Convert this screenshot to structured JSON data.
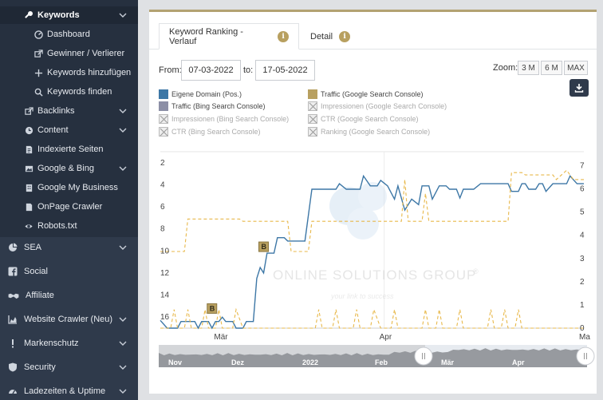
{
  "sidebar": {
    "keywords_label": "Keywords",
    "sub_items": [
      {
        "label": "Dashboard",
        "icon": "gauge-icon"
      },
      {
        "label": "Gewinner / Verlierer",
        "icon": "external-link-icon"
      },
      {
        "label": "Keywords hinzufügen",
        "icon": "plus-icon"
      },
      {
        "label": "Keywords finden",
        "icon": "search-icon"
      }
    ],
    "items": [
      {
        "label": "Backlinks",
        "icon": "external-link-icon"
      },
      {
        "label": "Content",
        "icon": "clock-icon"
      },
      {
        "label": "Indexierte Seiten",
        "icon": "document-icon"
      },
      {
        "label": "Google & Bing",
        "icon": "image-icon"
      },
      {
        "label": "Google My Business",
        "icon": "building-icon"
      },
      {
        "label": "OnPage Crawler",
        "icon": "file-icon"
      },
      {
        "label": "Robots.txt",
        "icon": "eye-icon"
      }
    ],
    "main_items": [
      {
        "label": "SEA",
        "icon": "pie-chart-icon"
      },
      {
        "label": "Social",
        "icon": "facebook-icon"
      },
      {
        "label": "Affiliate",
        "icon": "handshake-icon"
      },
      {
        "label": "Website Crawler (Neu)",
        "icon": "area-chart-icon"
      },
      {
        "label": "Markenschutz",
        "icon": "exclamation-icon"
      },
      {
        "label": "Security",
        "icon": "shield-icon"
      },
      {
        "label": "Ladezeiten & Uptime",
        "icon": "speedometer-icon"
      }
    ]
  },
  "tabs": [
    {
      "label": "Keyword Ranking - Verlauf",
      "info": "i"
    },
    {
      "label": "Detail",
      "info": "i"
    }
  ],
  "filters": {
    "from_label": "From:",
    "from_value": "07-03-2022",
    "to_label": "to:",
    "to_value": "17-05-2022",
    "zoom_label": "Zoom:",
    "zoom_options": [
      "3 M",
      "6 M",
      "MAX"
    ]
  },
  "legend": [
    {
      "label": "Eigene Domain (Pos.)",
      "color": "#3d77a6",
      "active": true
    },
    {
      "label": "Traffic (Google Search Console)",
      "color": "#b8a060",
      "active": true
    },
    {
      "label": "Traffic (Bing Search Console)",
      "color": "#8c8fa6",
      "active": true
    },
    {
      "label": "Impressionen (Google Search Console)",
      "active": false
    },
    {
      "label": "Impressionen (Bing Search Console)",
      "active": false
    },
    {
      "label": "CTR (Google Search Console)",
      "active": false
    },
    {
      "label": "CTR (Bing Search Console)",
      "active": false
    },
    {
      "label": "Ranking (Google Search Console)",
      "active": false
    }
  ],
  "watermark": {
    "brand": "ONLINE SOLUTIONS GROUP",
    "reg": "®",
    "tagline": "your link to success"
  },
  "chart_data": {
    "type": "line",
    "x_ticks": [
      "Mär",
      "Apr",
      "Ma"
    ],
    "y_left": {
      "ticks": [
        2,
        4,
        6,
        8,
        10,
        12,
        14,
        16
      ],
      "reversed": true,
      "range": [
        1,
        17
      ]
    },
    "y_right": {
      "ticks": [
        0,
        1,
        2,
        3,
        4,
        5,
        6,
        7
      ],
      "range": [
        0,
        7.6
      ]
    },
    "annotation_label": "B",
    "annotations": [
      {
        "day": 15,
        "pos": 15.8
      },
      {
        "day": 30,
        "pos": 10.2
      }
    ],
    "series": [
      {
        "name": "Eigene Domain (Pos.)",
        "axis": "left",
        "color": "#3d77a6",
        "style": "solid",
        "points": [
          [
            0,
            16.3
          ],
          [
            2,
            17
          ],
          [
            5,
            17
          ],
          [
            6,
            16.4
          ],
          [
            10,
            16.4
          ],
          [
            11,
            17
          ],
          [
            12,
            16.4
          ],
          [
            14,
            16.4
          ],
          [
            15,
            17
          ],
          [
            16,
            16.4
          ],
          [
            17,
            16.4
          ],
          [
            18,
            16
          ],
          [
            19,
            16.4
          ],
          [
            21,
            16.4
          ],
          [
            22,
            17
          ],
          [
            24,
            17
          ],
          [
            25,
            16.4
          ],
          [
            27,
            16.4
          ],
          [
            28,
            12.5
          ],
          [
            29,
            11.5
          ],
          [
            30,
            12
          ],
          [
            31,
            10.2
          ],
          [
            33,
            10.2
          ],
          [
            34,
            8.8
          ],
          [
            36,
            8.8
          ],
          [
            37,
            9.1
          ],
          [
            42,
            9.1
          ],
          [
            44,
            4.4
          ],
          [
            51,
            4.4
          ],
          [
            52,
            3.9
          ],
          [
            54,
            4.4
          ],
          [
            58,
            4.4
          ],
          [
            59,
            3.2
          ],
          [
            61,
            4.1
          ],
          [
            63,
            4.1
          ],
          [
            64,
            3.6
          ],
          [
            66,
            4.1
          ],
          [
            68,
            5.3
          ],
          [
            69,
            4.1
          ],
          [
            71,
            6.3
          ],
          [
            72,
            5.8
          ],
          [
            73,
            5.3
          ],
          [
            75,
            5.8
          ],
          [
            76,
            4.1
          ],
          [
            78,
            4.1
          ],
          [
            79,
            5.3
          ],
          [
            81,
            4.1
          ],
          [
            83,
            4.1
          ],
          [
            84,
            4.4
          ],
          [
            86,
            4.4
          ],
          [
            87,
            5.2
          ],
          [
            88,
            4.4
          ],
          [
            91,
            4.4
          ],
          [
            93,
            3.9
          ],
          [
            96,
            3.9
          ],
          [
            101,
            3.9
          ],
          [
            102,
            4.6
          ],
          [
            104,
            4.6
          ],
          [
            105,
            3.9
          ],
          [
            106,
            3.9
          ],
          [
            107,
            4.4
          ],
          [
            109,
            4.4
          ],
          [
            110,
            3.9
          ],
          [
            111,
            3.9
          ],
          [
            112,
            4.6
          ],
          [
            114,
            3.9
          ],
          [
            118,
            3.9
          ],
          [
            119,
            3.2
          ],
          [
            121,
            3.9
          ],
          [
            123,
            3.9
          ]
        ]
      },
      {
        "name": "Traffic (Google Search Console)",
        "axis": "right",
        "color": "#e8b84a",
        "style": "dashed",
        "points": [
          [
            0,
            3.3
          ],
          [
            7,
            3.3
          ],
          [
            8,
            4.7
          ],
          [
            23,
            4.7
          ],
          [
            24,
            4.6
          ],
          [
            37,
            4.6
          ],
          [
            38,
            3.3
          ],
          [
            43,
            3.3
          ],
          [
            44,
            4.6
          ],
          [
            70,
            4.6
          ],
          [
            71,
            6.4
          ],
          [
            72,
            4.6
          ],
          [
            76,
            4.6
          ],
          [
            77,
            5.8
          ],
          [
            78,
            4.6
          ],
          [
            83,
            4.6
          ],
          [
            84,
            4.6
          ],
          [
            101,
            4.6
          ],
          [
            102,
            6.7
          ],
          [
            105,
            6.7
          ],
          [
            106,
            6.6
          ],
          [
            110,
            6.6
          ],
          [
            114,
            6.6
          ],
          [
            115,
            6.4
          ],
          [
            118,
            6.8
          ],
          [
            120,
            6.4
          ],
          [
            123,
            6.4
          ]
        ]
      },
      {
        "name": "Traffic (Google Search Console) low",
        "axis": "right",
        "color": "#e8b84a",
        "style": "dashed",
        "points": [
          [
            0,
            0
          ],
          [
            3,
            0
          ],
          [
            4,
            0.8
          ],
          [
            5,
            0
          ],
          [
            7,
            0
          ],
          [
            8,
            0.8
          ],
          [
            9,
            0
          ],
          [
            12,
            0
          ],
          [
            13,
            0.8
          ],
          [
            14,
            0
          ],
          [
            16,
            0
          ],
          [
            17,
            0.8
          ],
          [
            18,
            0
          ],
          [
            21,
            0
          ],
          [
            22,
            0.8
          ],
          [
            24,
            0
          ],
          [
            45,
            0
          ],
          [
            46,
            0.8
          ],
          [
            47,
            0
          ],
          [
            50,
            0
          ],
          [
            51,
            0.8
          ],
          [
            52,
            0
          ],
          [
            56,
            0
          ],
          [
            57,
            0.8
          ],
          [
            58,
            0
          ],
          [
            61,
            0
          ],
          [
            62,
            0.8
          ],
          [
            64,
            0
          ],
          [
            67,
            0
          ],
          [
            68,
            0.8
          ],
          [
            69,
            0
          ],
          [
            76,
            0
          ],
          [
            77,
            0.8
          ],
          [
            78,
            0
          ],
          [
            80,
            0
          ],
          [
            81,
            0.8
          ],
          [
            82,
            0
          ],
          [
            86,
            0
          ],
          [
            87,
            0.8
          ],
          [
            88,
            0
          ],
          [
            95,
            0
          ],
          [
            96,
            0.8
          ],
          [
            97,
            0
          ],
          [
            99,
            0
          ],
          [
            100,
            0.8
          ],
          [
            101,
            0
          ],
          [
            103,
            0
          ],
          [
            104,
            0.8
          ],
          [
            105,
            0
          ],
          [
            123,
            0
          ]
        ]
      }
    ],
    "navigator": {
      "labels": [
        "Nov",
        "Dez",
        "2022",
        "Feb",
        "Mär",
        "Apr"
      ]
    }
  }
}
